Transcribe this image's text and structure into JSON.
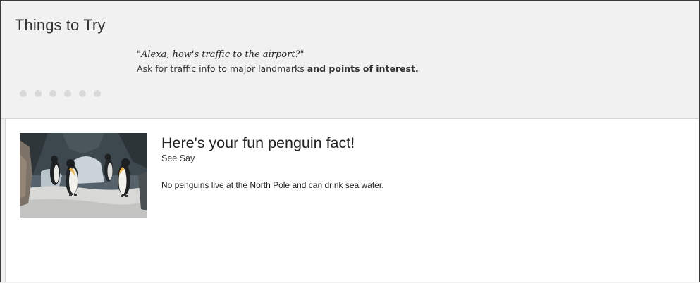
{
  "things_to_try": {
    "title": "Things to Try",
    "quote": "\"Alexa, how's traffic to the airport?\"",
    "hint_plain": "Ask for traffic info to major landmarks ",
    "hint_bold": "and points of interest.",
    "page_count": 6
  },
  "card": {
    "title": "Here's your fun penguin fact!",
    "subtitle": "See Say",
    "body": "No penguins live at the North Pole and can drink sea water.",
    "image_icon": "penguin-photo"
  }
}
